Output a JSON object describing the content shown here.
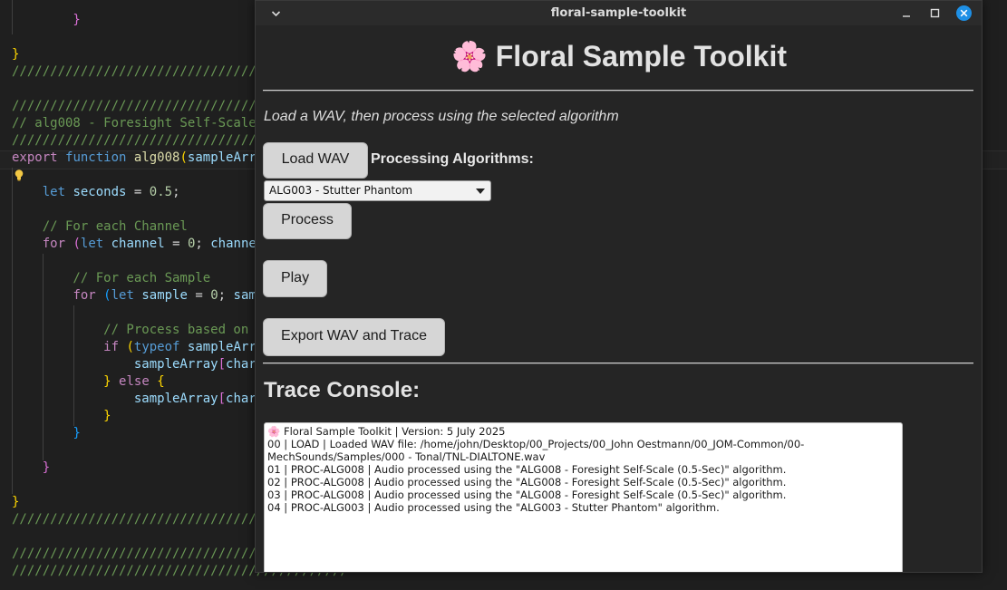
{
  "editor": {
    "lines": [
      {
        "t": "    }"
      },
      {
        "t": ""
      },
      {
        "t": "}"
      },
      {
        "t": "////////////////////////////////////////////"
      },
      {
        "t": ""
      },
      {
        "t": "////////////////////////////////////////////"
      },
      {
        "t": "// alg008 - Foresight Self-Scale"
      },
      {
        "t": "////////////////////////////////////////////"
      },
      {
        "t": "export function alg008(sampleArr"
      },
      {
        "t": ""
      },
      {
        "t": "    let seconds = 0.5;"
      },
      {
        "t": ""
      },
      {
        "t": "    // For each Channel"
      },
      {
        "t": "    for (let channel = 0; channe"
      },
      {
        "t": ""
      },
      {
        "t": "        // For each Sample"
      },
      {
        "t": "        for (let sample = 0; sam"
      },
      {
        "t": ""
      },
      {
        "t": "            // Process based on"
      },
      {
        "t": "            if (typeof sampleArr"
      },
      {
        "t": "                sampleArray[char"
      },
      {
        "t": "            } else {"
      },
      {
        "t": "                sampleArray[char"
      },
      {
        "t": "            }"
      },
      {
        "t": "        }"
      },
      {
        "t": ""
      },
      {
        "t": "    }"
      },
      {
        "t": ""
      },
      {
        "t": "}"
      },
      {
        "t": "////////////////////////////////////////////"
      },
      {
        "t": ""
      },
      {
        "t": "////////////////////////////////////////////"
      },
      {
        "t": "////////////////////////////////////////////"
      }
    ]
  },
  "window": {
    "title": "floral-sample-toolkit"
  },
  "app": {
    "title": "🌸 Floral Sample Toolkit",
    "subtitle": "Load a WAV, then process using the selected algorithm",
    "load_button": "Load WAV",
    "algorithms_label": "Processing Algorithms:",
    "selected_algorithm": "ALG003 - Stutter Phantom",
    "process_button": "Process",
    "play_button": "Play",
    "export_button": "Export WAV and Trace",
    "trace_heading": "Trace Console:",
    "trace_lines": [
      "🌸 Floral Sample Toolkit | Version: 5 July 2025",
      "00 | LOAD | Loaded WAV file: /home/john/Desktop/00_Projects/00_John Oestmann/00_JOM-Common/00-MechSounds/Samples/000 - Tonal/TNL-DIALTONE.wav",
      "01 | PROC-ALG008 | Audio processed using the \"ALG008 - Foresight Self-Scale (0.5-Sec)\" algorithm.",
      "02 | PROC-ALG008 | Audio processed using the \"ALG008 - Foresight Self-Scale (0.5-Sec)\" algorithm.",
      "03 | PROC-ALG008 | Audio processed using the \"ALG008 - Foresight Self-Scale (0.5-Sec)\" algorithm.",
      "04 | PROC-ALG003 | Audio processed using the \"ALG003 - Stutter Phantom\" algorithm."
    ]
  },
  "icons": {
    "menu": "chevron-down-icon",
    "minimize": "minimize-icon",
    "maximize": "maximize-icon",
    "close": "close-icon",
    "bulb": "lightbulb-icon"
  },
  "colors": {
    "editor_bg": "#1f1f1f",
    "window_bg": "#252525",
    "button_bg": "#d6d6d6",
    "close_accent": "#1e90e6"
  }
}
